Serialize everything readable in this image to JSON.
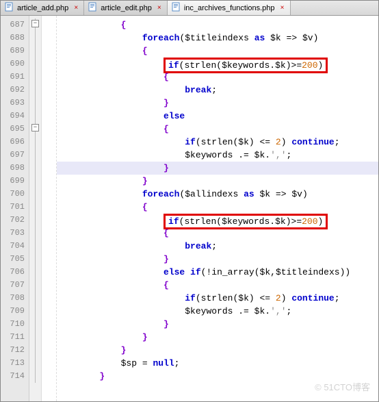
{
  "tabs": [
    {
      "label": "article_add.php",
      "active": false
    },
    {
      "label": "article_edit.php",
      "active": false
    },
    {
      "label": "inc_archives_functions.php",
      "active": true
    }
  ],
  "line_start": 687,
  "line_end": 714,
  "code_lines": [
    "            {",
    "                foreach($titleindexs as $k => $v)",
    "                {",
    "                    if(strlen($keywords.$k)>=200)",
    "                    {",
    "                        break;",
    "                    }",
    "                    else",
    "                    {",
    "                        if(strlen($k) <= 2) continue;",
    "                        $keywords .= $k.',';",
    "                    }",
    "                }",
    "                foreach($allindexs as $k => $v)",
    "                {",
    "                    if(strlen($keywords.$k)>=200)",
    "                    {",
    "                        break;",
    "                    }",
    "                    else if(!in_array($k,$titleindexs))",
    "                    {",
    "                        if(strlen($k) <= 2) continue;",
    "                        $keywords .= $k.',';",
    "                    }",
    "                }",
    "            }",
    "            $sp = null;",
    "        }"
  ],
  "watermark": "© 51CTO博客"
}
